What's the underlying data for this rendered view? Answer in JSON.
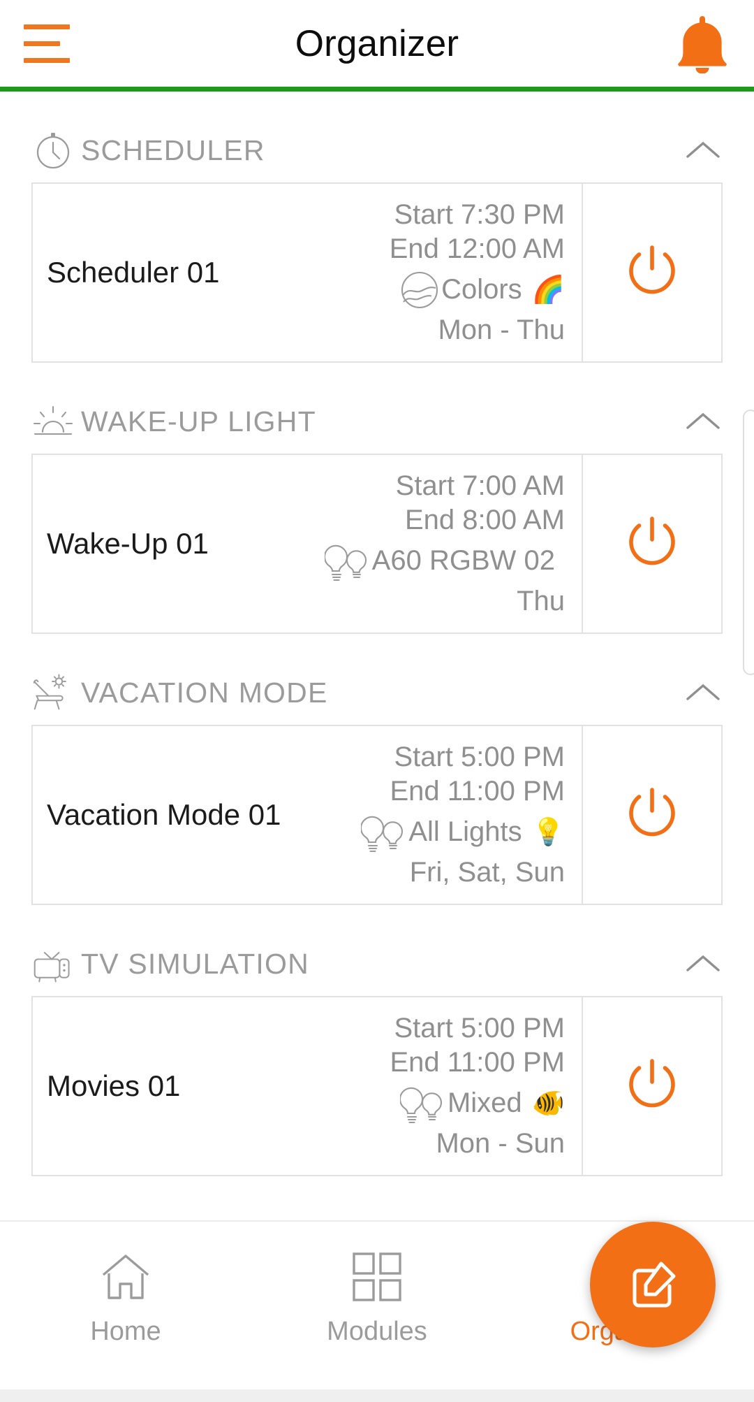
{
  "theme": {
    "accent": "#f26f16",
    "accent_line": "#1a9b1a",
    "muted_text": "#8f8f8f",
    "title_text": "#0d0d0d",
    "border": "#e2e2e2"
  },
  "header": {
    "menu_icon": "hamburger-menu-icon",
    "title": "Organizer",
    "notification_icon": "bell-icon"
  },
  "sections": [
    {
      "id": "scheduler",
      "icon": "stopwatch-clock-icon",
      "title": "SCHEDULER",
      "collapse_icon": "chevron-up-icon",
      "items": [
        {
          "name": "Scheduler 01",
          "start": "Start 7:30 PM",
          "end": "End 12:00 AM",
          "device_icon": "color-wave-circle-icon",
          "device": "Colors",
          "emoji": "🌈",
          "days": "Mon - Thu",
          "power_icon": "power-icon"
        }
      ]
    },
    {
      "id": "wake-up-light",
      "icon": "sunrise-icon",
      "title": "WAKE-UP LIGHT",
      "collapse_icon": "chevron-up-icon",
      "items": [
        {
          "name": "Wake-Up 01",
          "start": "Start 7:00 AM",
          "end": "End 8:00 AM",
          "device_icon": "two-bulbs-icon",
          "device": "A60 RGBW 02",
          "emoji": "",
          "days": "Thu",
          "power_icon": "power-icon"
        }
      ]
    },
    {
      "id": "vacation-mode",
      "icon": "deck-chair-sun-icon",
      "title": "VACATION MODE",
      "collapse_icon": "chevron-up-icon",
      "items": [
        {
          "name": "Vacation Mode 01",
          "start": "Start 5:00 PM",
          "end": "End 11:00 PM",
          "device_icon": "two-bulbs-icon",
          "device": "All Lights",
          "emoji": "💡",
          "days": "Fri, Sat, Sun",
          "power_icon": "power-icon"
        }
      ]
    },
    {
      "id": "tv-simulation",
      "icon": "retro-tv-icon",
      "title": "TV SIMULATION",
      "collapse_icon": "chevron-up-icon",
      "items": [
        {
          "name": "Movies 01",
          "start": "Start 5:00 PM",
          "end": "End 11:00 PM",
          "device_icon": "two-bulbs-icon",
          "device": "Mixed",
          "emoji": "🐠",
          "days": "Mon - Sun",
          "power_icon": "power-icon"
        }
      ]
    }
  ],
  "fab": {
    "icon": "edit-pencil-square-icon",
    "label": ""
  },
  "bottom_nav": {
    "items": [
      {
        "icon": "home-icon",
        "label": "Home",
        "active": false
      },
      {
        "icon": "grid-icon",
        "label": "Modules",
        "active": false
      },
      {
        "icon": "clock-filled-icon",
        "label": "Organizer",
        "active": true
      }
    ]
  }
}
